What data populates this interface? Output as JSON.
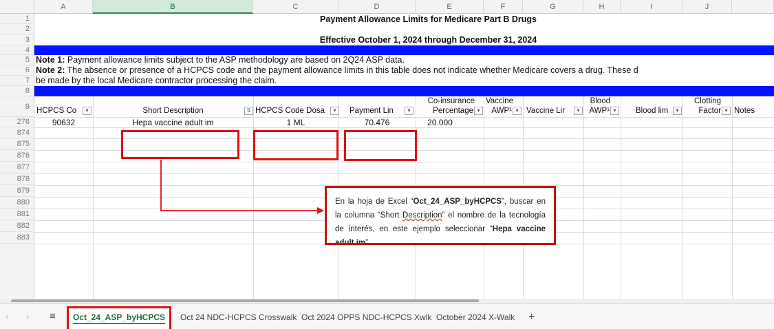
{
  "columns": [
    "A",
    "B",
    "C",
    "D",
    "E",
    "F",
    "G",
    "H",
    "I",
    "J"
  ],
  "rows": {
    "r1": "1",
    "r2": "2",
    "r3": "3",
    "r4": "4",
    "r5": "5",
    "r6": "6",
    "r7": "7",
    "r8": "8",
    "r9": "9",
    "r276": "276",
    "tail": [
      "874",
      "875",
      "876",
      "877",
      "878",
      "879",
      "880",
      "881",
      "882",
      "883"
    ]
  },
  "title": "Payment Allowance Limits for Medicare Part B Drugs",
  "subtitle": "Effective October 1, 2024 through December 31, 2024",
  "note1": {
    "label": "Note 1:",
    "text": " Payment allowance limits subject to the ASP methodology are based on 2Q24 ASP data."
  },
  "note2": {
    "label": "Note 2:",
    "text": " The absence or presence of a HCPCS code and the payment allowance limits in this table does not indicate whether Medicare covers a drug.  These d"
  },
  "note2_cont": "be made by the local Medicare contractor processing the claim.",
  "headers": {
    "a": "HCPCS Co",
    "b": "Short Description",
    "c": "HCPCS Code Dosa",
    "d": "Payment Lin",
    "e1": "Co-insurance",
    "e2": "Percentage",
    "f1": "Vaccine",
    "f2": "AWP¹",
    "g": "Vaccine Lir",
    "h1": "Blood",
    "h2": "AWP¹",
    "i": "Blood lim",
    "j1": "Clotting",
    "j2": "Factor",
    "k": "Notes"
  },
  "data_row": {
    "a": "90632",
    "b": "Hepa vaccine adult im",
    "c": "1 ML",
    "d": "70.476",
    "e": "20.000"
  },
  "callout": {
    "t1": "En la hoja de Excel “",
    "t2": "Oct_24_ASP_byHCPCS",
    "t3": "”, buscar en la columna “Short ",
    "t4": "Description",
    "t5": "” el nombre de la tecnología de interés, en este ejemplo seleccionar “",
    "t6": "Hepa vaccine adult im",
    "t7": "”."
  },
  "tabs": {
    "active": "Oct_24_ASP_byHCPCS",
    "t2": "Oct 24 NDC-HCPCS Crosswalk",
    "t3": "Oct 2024 OPPS NDC-HCPCS Xwlk",
    "t4": "October 2024 X-Walk",
    "add": "+"
  },
  "icons": {
    "prev": "chevron-left-icon",
    "next": "chevron-right-icon",
    "menu": "menu-icon",
    "filter": "filter-dropdown-icon"
  },
  "colors": {
    "blue_band": "#0014ff",
    "highlight_red": "#e01111",
    "selected_col": "#d3e9d9"
  }
}
